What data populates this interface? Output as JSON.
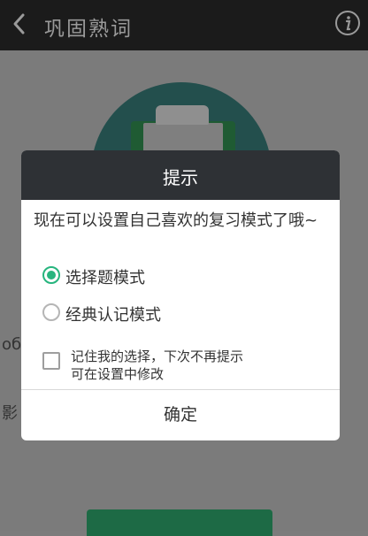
{
  "header": {
    "title": "巩固熟词",
    "back_icon": "chevron-left-icon",
    "info_icon": "info-icon"
  },
  "background": {
    "side_char_1": "об",
    "side_char_2": "影"
  },
  "dialog": {
    "title": "提示",
    "message": "现在可以设置自己喜欢的复习模式了哦~",
    "options": [
      {
        "label": "选择题模式",
        "selected": true
      },
      {
        "label": "经典认记模式",
        "selected": false
      }
    ],
    "remember": {
      "line1": "记住我的选择，下次不再提示",
      "line2": "可在设置中修改",
      "checked": false
    },
    "confirm_label": "确定"
  },
  "colors": {
    "accent": "#27b57e",
    "header_bg": "#1b1b1b",
    "dialog_header_bg": "#2e3135"
  }
}
